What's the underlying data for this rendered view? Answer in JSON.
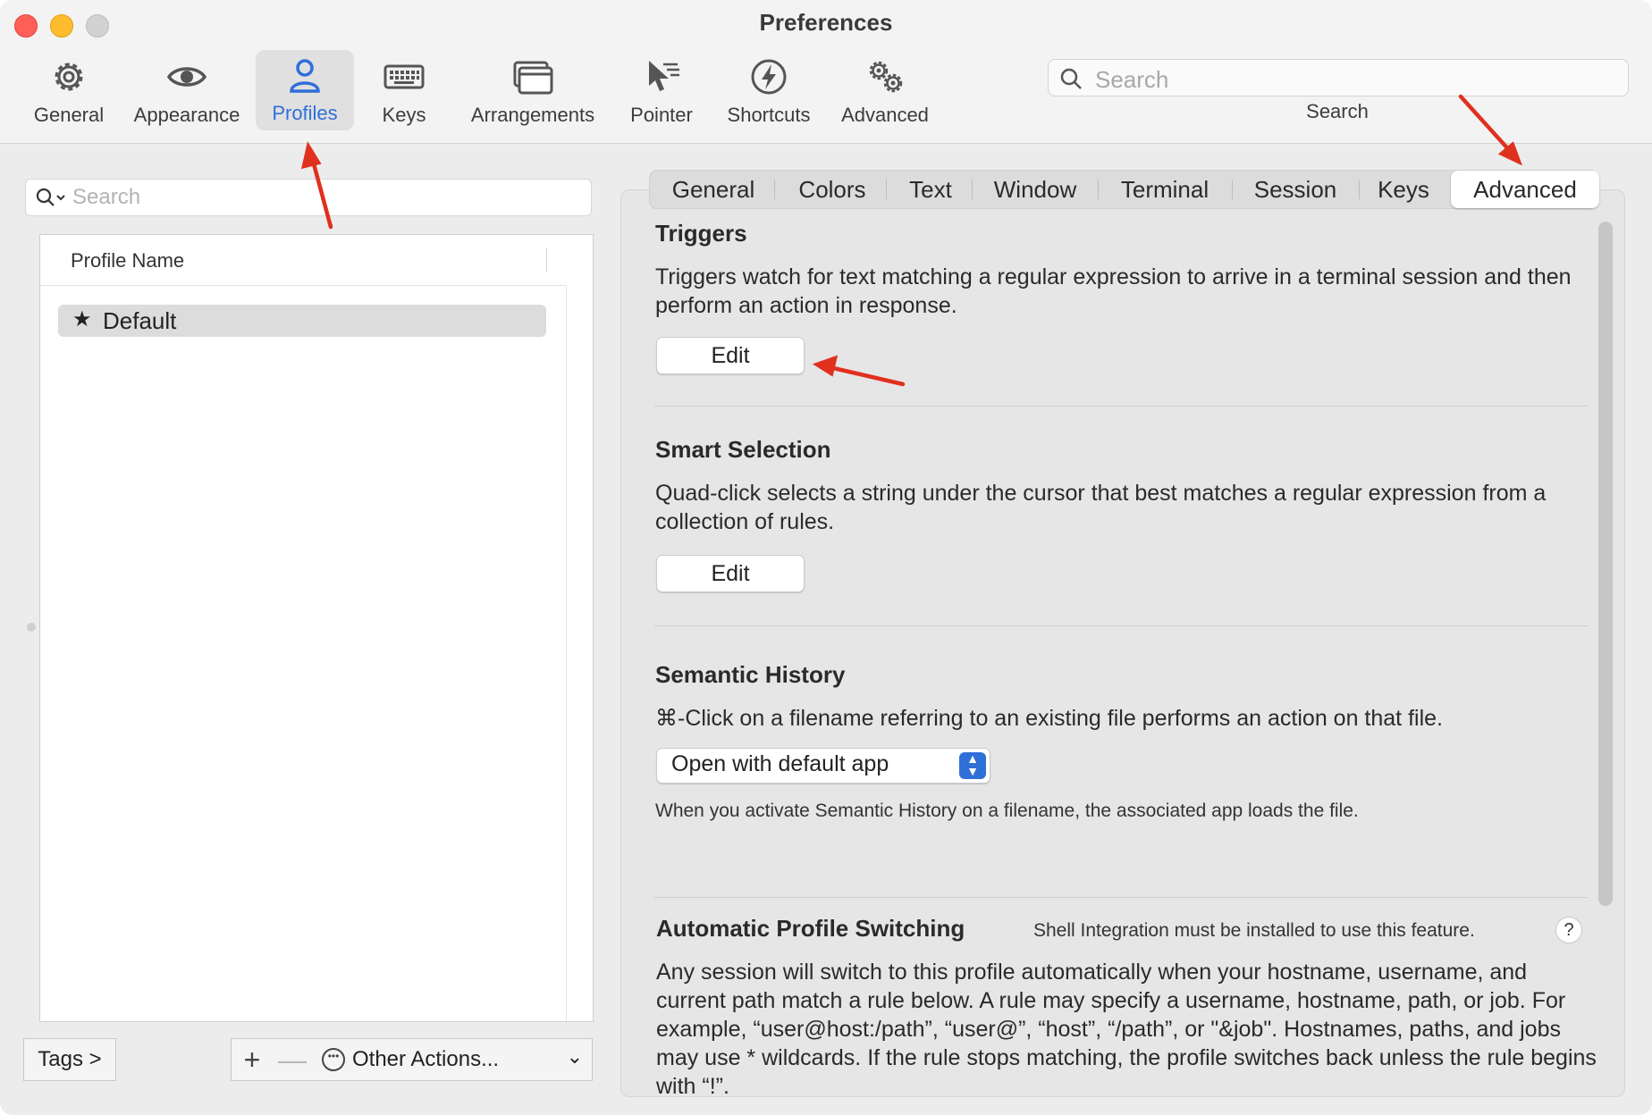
{
  "window": {
    "title": "Preferences"
  },
  "toolbar": {
    "items": [
      {
        "label": "General",
        "icon": "gear-icon"
      },
      {
        "label": "Appearance",
        "icon": "eye-icon"
      },
      {
        "label": "Profiles",
        "icon": "person-icon",
        "selected": true
      },
      {
        "label": "Keys",
        "icon": "keyboard-icon"
      },
      {
        "label": "Arrangements",
        "icon": "windows-icon"
      },
      {
        "label": "Pointer",
        "icon": "pointer-icon"
      },
      {
        "label": "Shortcuts",
        "icon": "bolt-icon"
      },
      {
        "label": "Advanced",
        "icon": "gears-icon"
      }
    ],
    "search": {
      "placeholder": "Search",
      "label": "Search"
    }
  },
  "profiles": {
    "search_placeholder": "Search",
    "column_header": "Profile Name",
    "items": [
      {
        "name": "Default",
        "default": true,
        "selected": true
      }
    ],
    "tags_button": "Tags >",
    "add_button": "+",
    "remove_button": "—",
    "other_actions": "Other Actions..."
  },
  "tabs": {
    "items": [
      "General",
      "Colors",
      "Text",
      "Window",
      "Terminal",
      "Session",
      "Keys",
      "Advanced"
    ],
    "selected": "Advanced"
  },
  "advanced": {
    "triggers": {
      "title": "Triggers",
      "description": "Triggers watch for text matching a regular expression to arrive in a terminal session and then perform an action in response.",
      "button": "Edit"
    },
    "smart_selection": {
      "title": "Smart Selection",
      "description": "Quad-click selects a string under the cursor that best matches a regular expression from a collection of rules.",
      "button": "Edit"
    },
    "semantic_history": {
      "title": "Semantic History",
      "description": "⌘-Click on a filename referring to an existing file performs an action on that file.",
      "select_value": "Open with default app",
      "note": "When you activate Semantic History on a filename, the associated app loads the file."
    },
    "automatic_profile_switching": {
      "title": "Automatic Profile Switching",
      "shell_note": "Shell Integration must be installed to use this feature.",
      "help": "?",
      "description": "Any session will switch to this profile automatically when your hostname, username, and current path match a rule below. A rule may specify a username, hostname, path, or job. For example, “user@host:/path”, “user@”, “host”, “/path”, or \"&job\". Hostnames, paths, and jobs may use * wildcards. If the rule stops matching, the profile switches back unless the rule begins with “!”."
    }
  },
  "colors": {
    "accent": "#2f6fd8",
    "annotation_arrow": "#e0301e"
  }
}
